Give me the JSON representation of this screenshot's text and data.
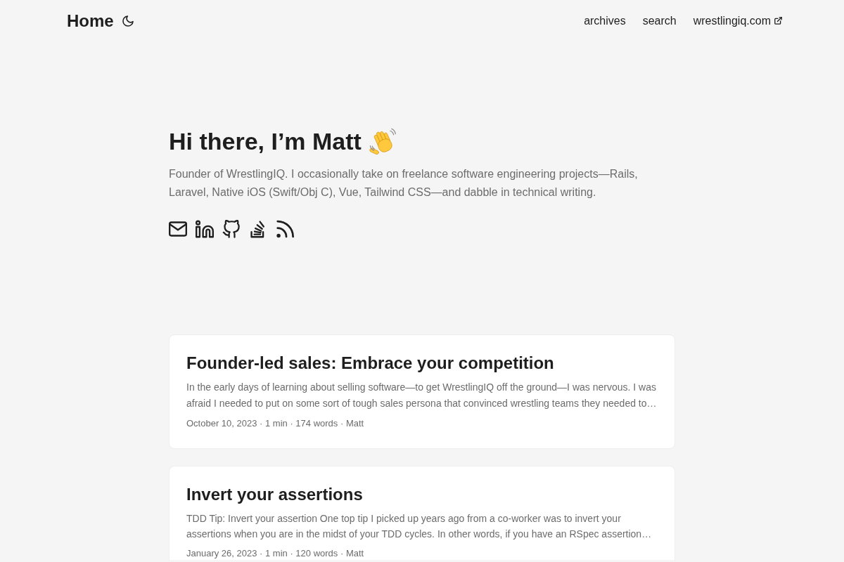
{
  "header": {
    "logo": "Home",
    "menu": [
      {
        "label": "archives",
        "external": false
      },
      {
        "label": "search",
        "external": false
      },
      {
        "label": "wrestlingiq.com",
        "external": true
      }
    ]
  },
  "intro": {
    "title": "Hi there, I’m Matt",
    "description": "Founder of WrestlingIQ. I occasionally take on freelance software engineering projects—Rails, Laravel, Native iOS (Swift/Obj C), Vue, Tailwind CSS—and dabble in technical writing.",
    "social": [
      {
        "kind": "email"
      },
      {
        "kind": "linkedin"
      },
      {
        "kind": "github"
      },
      {
        "kind": "stackoverflow"
      },
      {
        "kind": "rss"
      }
    ]
  },
  "posts": [
    {
      "title": "Founder-led sales: Embrace your competition",
      "summary": "In the early days of learning about selling software—to get WrestlingIQ off the ground—I was nervous. I was afraid I needed to put on some sort of tough sales persona that convinced wrestling teams they needed to…",
      "meta": "October 10, 2023 · 1 min · 174 words · Matt"
    },
    {
      "title": "Invert your assertions",
      "summary": "TDD Tip: Invert your assertion One top tip I picked up years ago from a co-worker was to invert your assertions when you are in the midst of your TDD cycles. In other words, if you have an RSpec assertion…",
      "meta": "January 26, 2023 · 1 min · 120 words · Matt"
    }
  ]
}
